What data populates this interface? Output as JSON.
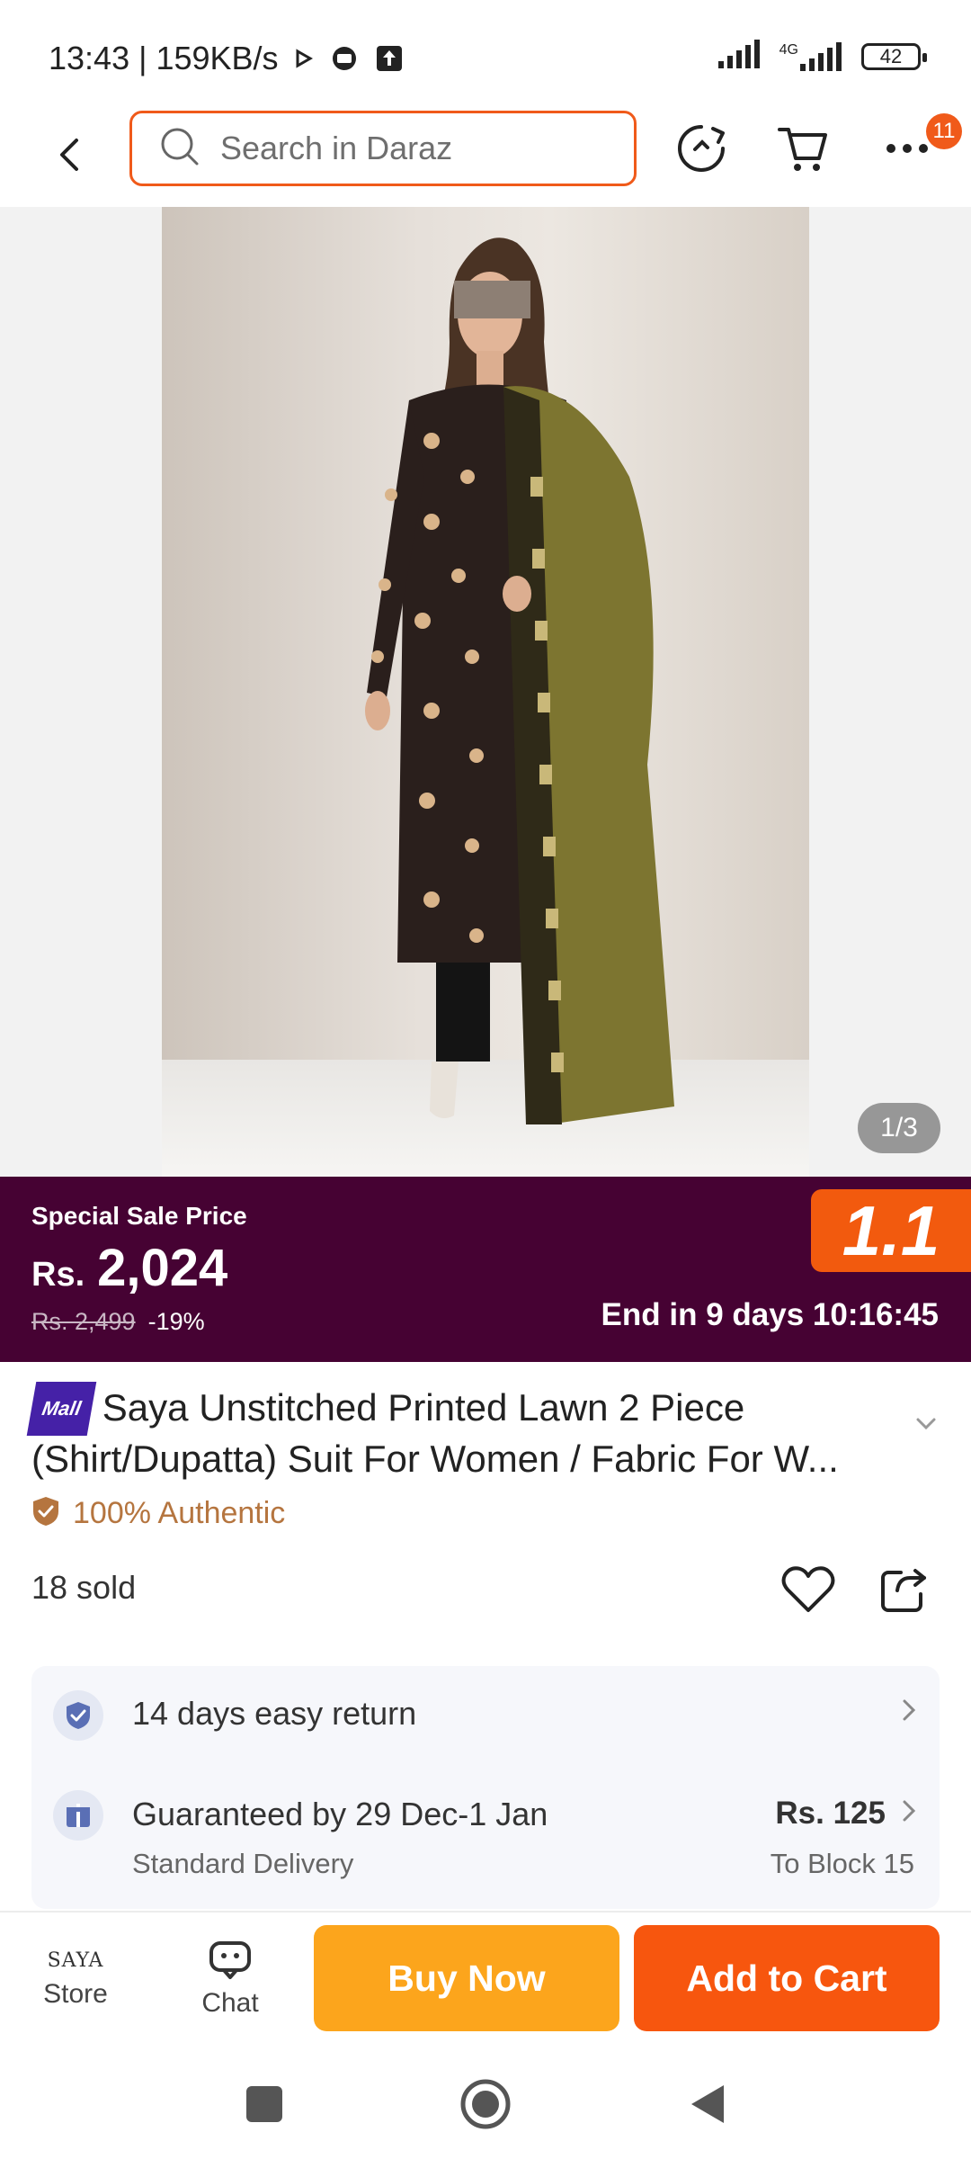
{
  "status_bar": {
    "time": "13:43",
    "net_speed": "159KB/s",
    "network": "4G",
    "battery": "42"
  },
  "nav": {
    "search_placeholder": "Search in Daraz",
    "cart_badge": "11"
  },
  "gallery": {
    "counter": "1/3"
  },
  "sale": {
    "label": "Special Sale Price",
    "currency": "Rs.",
    "price": "2,024",
    "original_price": "Rs. 2,499",
    "discount": "-19%",
    "event_tag": "1.1",
    "countdown": "End in 9 days 10:16:45"
  },
  "product": {
    "mall_badge": "Mall",
    "title": "Saya Unstitched Printed Lawn 2 Piece (Shirt/Dupatta) Suit For Women / Fabric For W...",
    "authentic": "100% Authentic",
    "sold": "18 sold"
  },
  "services": {
    "returns": "14 days easy return",
    "delivery_title": "Guaranteed by 29 Dec-1 Jan",
    "delivery_type": "Standard Delivery",
    "delivery_price": "Rs. 125",
    "delivery_dest": "To Block 15"
  },
  "bottom": {
    "store_logo": "SAYA",
    "store_label": "Store",
    "chat_label": "Chat",
    "buy_now": "Buy Now",
    "add_to_cart": "Add to Cart"
  },
  "colors": {
    "brand_orange": "#f7560e",
    "sale_purple": "#460233",
    "buy_now_yellow": "#fca51c"
  }
}
